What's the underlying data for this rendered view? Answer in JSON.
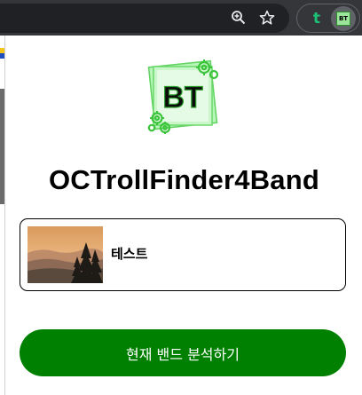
{
  "browser_toolbar": {
    "zoom_icon": "zoom-in-icon",
    "bookmark_icon": "star-icon",
    "extensions": [
      {
        "name": "t-extension",
        "glyph": "t",
        "color": "#1ec276"
      },
      {
        "name": "bt-extension",
        "glyph": "BT",
        "color": "#9be59b",
        "active": true
      }
    ]
  },
  "popup": {
    "logo": {
      "text": "BT",
      "bg_color": "#9be59b",
      "gear_color": "#3cc43c"
    },
    "title": "OCTrollFinder4Band",
    "band": {
      "name": "테스트",
      "thumbnail": "mountain-sunset-forest"
    },
    "analyze_button": {
      "label": "현재 밴드 분석하기",
      "color": "#008000"
    }
  }
}
